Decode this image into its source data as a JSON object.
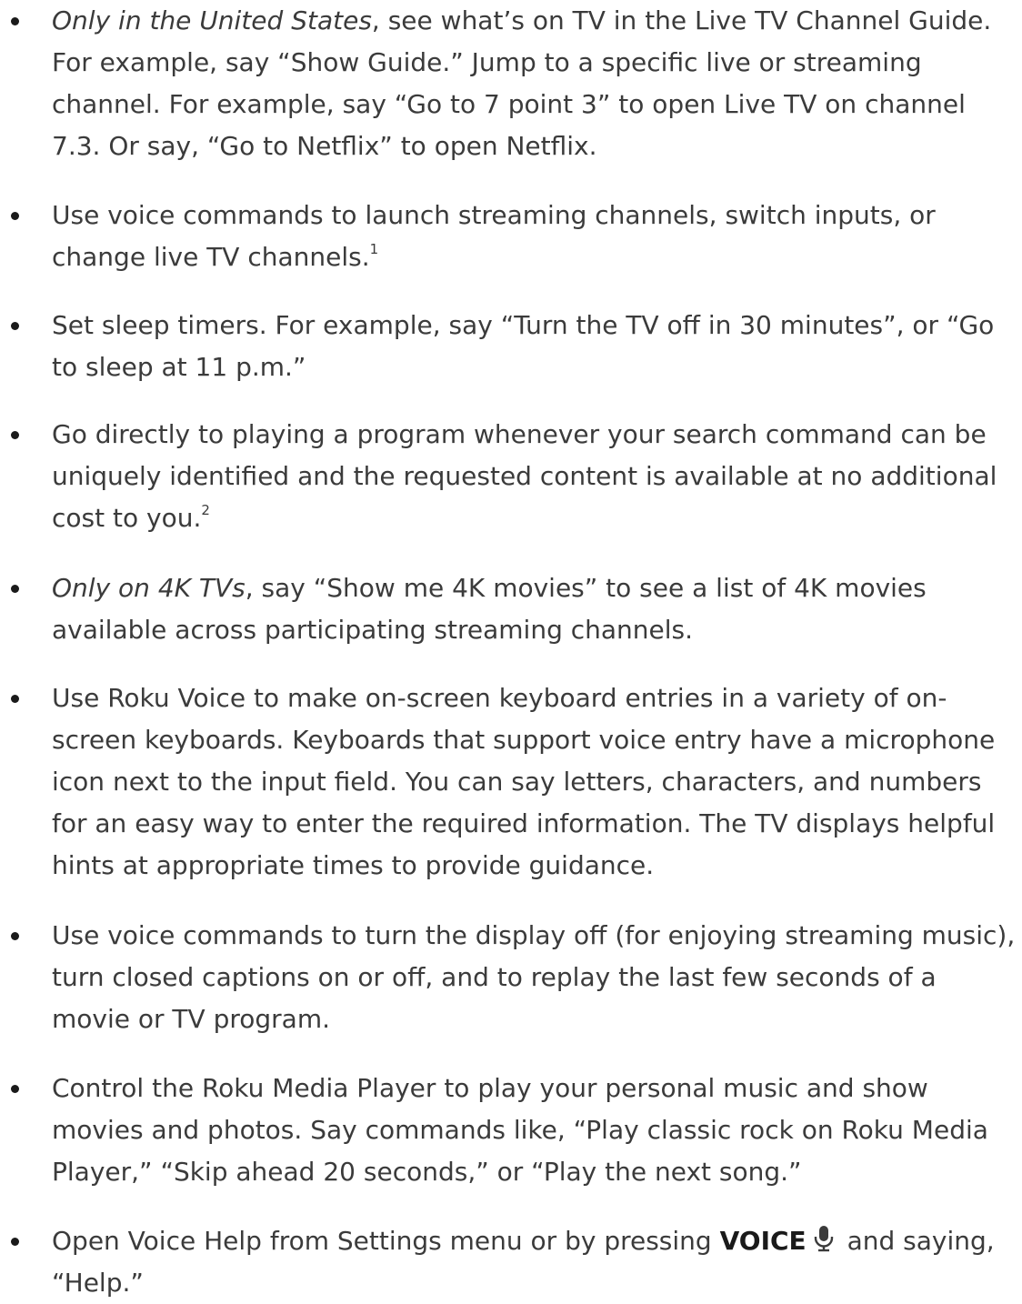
{
  "items": [
    {
      "italic": "Only in the United States",
      "text": ", see what’s on TV in the Live TV Channel Guide. For example, say “Show Guide.” Jump to a specific live or streaming channel. For example, say “Go to 7 point 3” to open Live TV on channel 7.3. Or say, “Go to Netflix” to open Netflix."
    },
    {
      "text": "Use voice commands to launch streaming channels, switch inputs, or change live TV channels.",
      "sup": "1"
    },
    {
      "text": "Set sleep timers. For example, say “Turn the TV off in 30 minutes”, or “Go to sleep at 11 p.m.”"
    },
    {
      "text": "Go directly to playing a program whenever your search command can be uniquely identified and the requested content is available at no additional cost to you.",
      "sup": "2"
    },
    {
      "italic": "Only on 4K TVs",
      "text": ", say “Show me 4K movies” to see a list of 4K movies available across participating streaming channels."
    },
    {
      "text": "Use Roku Voice to make on-screen keyboard entries in a variety of on-screen keyboards. Keyboards that support voice entry have a microphone icon next to the input field. You can say letters, characters, and numbers for an easy way to enter the required information. The TV displays helpful hints at appropriate times to provide guidance."
    },
    {
      "text": "Use voice commands to turn the display off (for enjoying streaming music), turn closed captions on or off, and to replay the last few seconds of a movie or TV program."
    },
    {
      "text": "Control the Roku Media Player to play your personal music and show movies and photos. Say commands like, “Play classic rock on Roku Media Player,” “Skip ahead 20 seconds,” or “Play the next song.”"
    },
    {
      "text_before": "Open Voice Help from Settings menu or by pressing",
      "strong": "VOICE",
      "icon": "microphone-icon",
      "text_after": "and saying, “Help.”"
    }
  ]
}
